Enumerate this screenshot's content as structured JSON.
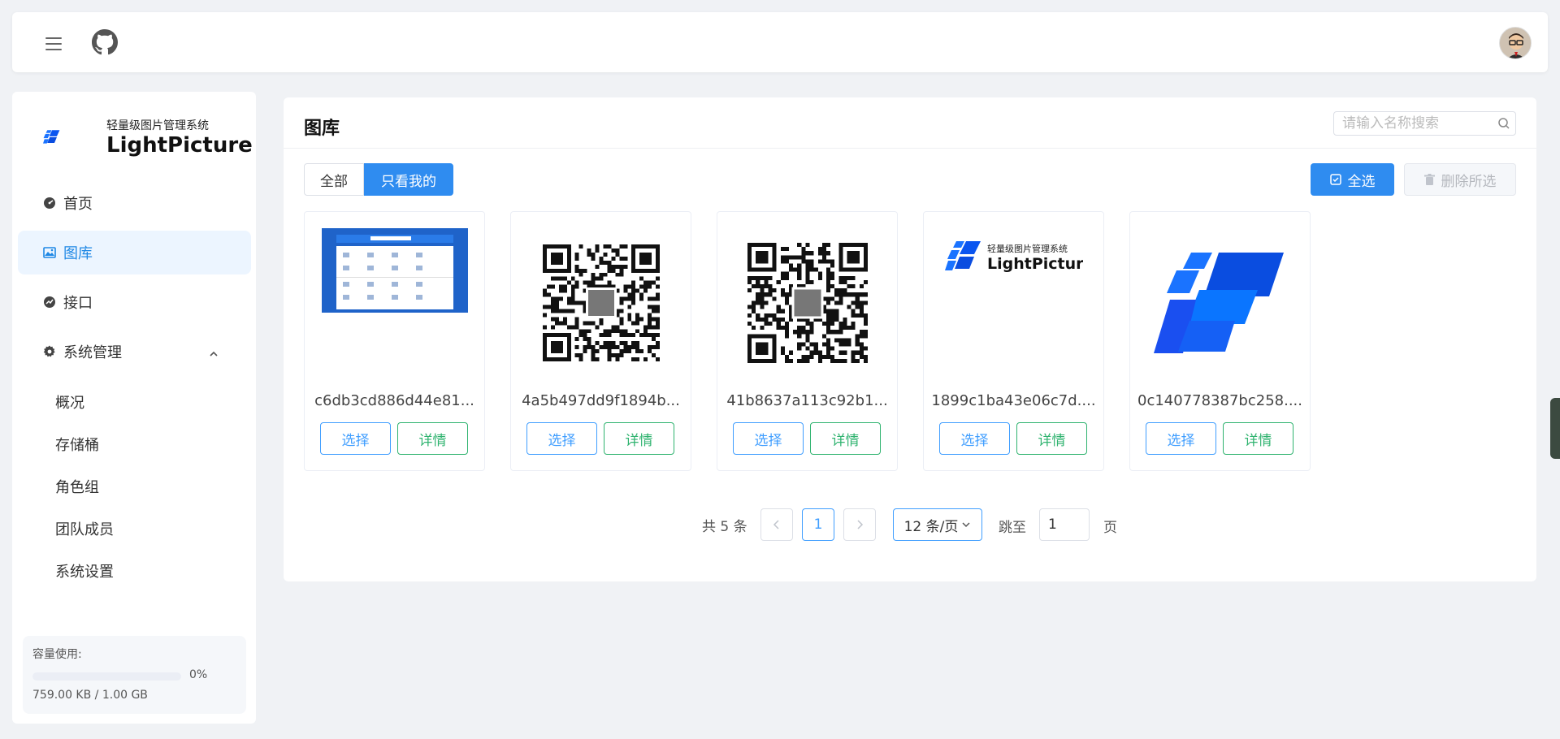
{
  "header": {
    "menu_icon": "hamburger-icon",
    "github_icon": "github-icon",
    "avatar_icon": "user-avatar"
  },
  "sidebar": {
    "logo_subtitle": "轻量级图片管理系统",
    "logo_title": "LightPicture",
    "nav": [
      {
        "label": "首页",
        "icon": "dashboard-icon"
      },
      {
        "label": "图库",
        "icon": "picture-icon"
      },
      {
        "label": "接口",
        "icon": "trend-icon"
      },
      {
        "label": "系统管理",
        "icon": "gear-icon"
      }
    ],
    "sub_items": [
      "概况",
      "存储桶",
      "角色组",
      "团队成员",
      "系统设置"
    ],
    "usage": {
      "label": "容量使用:",
      "percent_text": "0%",
      "percent": 0,
      "size_text": "759.00 KB / 1.00 GB"
    }
  },
  "main": {
    "title": "图库",
    "search_placeholder": "请输入名称搜索",
    "filter_all": "全部",
    "filter_mine": "只看我的",
    "select_all": "全选",
    "delete_selected": "删除所选",
    "cards": [
      {
        "name": "c6db3cd886d44e81...",
        "select": "选择",
        "detail": "详情",
        "thumb": "screenshot"
      },
      {
        "name": "4a5b497dd9f1894b...",
        "select": "选择",
        "detail": "详情",
        "thumb": "qrcode"
      },
      {
        "name": "41b8637a113c92b1...",
        "select": "选择",
        "detail": "详情",
        "thumb": "qrcode"
      },
      {
        "name": "1899c1ba43e06c7d....",
        "select": "选择",
        "detail": "详情",
        "thumb": "logo-text"
      },
      {
        "name": "0c140778387bc258....",
        "select": "选择",
        "detail": "详情",
        "thumb": "logo-mark"
      }
    ],
    "pagination": {
      "total": "共 5 条",
      "current_page": "1",
      "page_size": "12 条/页",
      "jump_label": "跳至",
      "jump_value": "1",
      "page_unit": "页"
    }
  },
  "colors": {
    "primary": "#2f8cf0",
    "success": "#2fb36f",
    "active_bg": "#ecf5ff"
  }
}
